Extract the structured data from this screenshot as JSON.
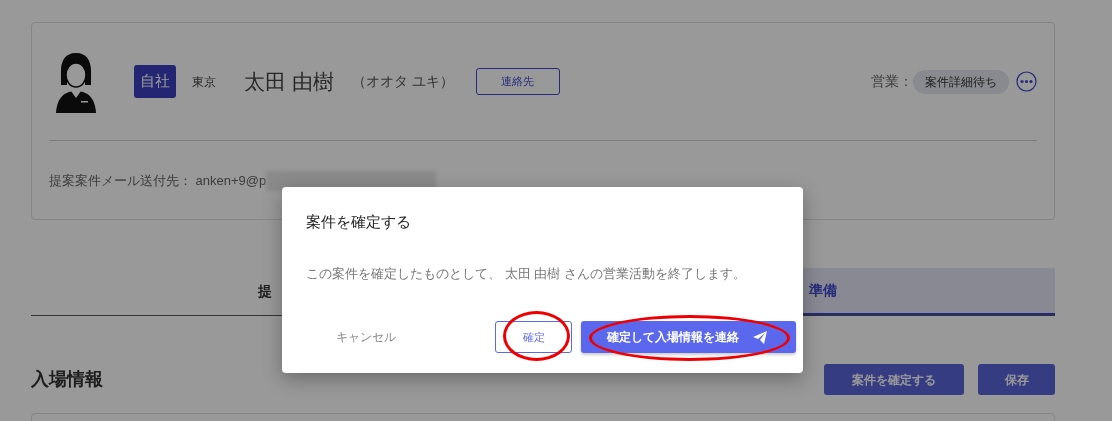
{
  "profile": {
    "badge": "自社",
    "location": "東京",
    "name": "太田 由樹",
    "kana": "（オオタ ユキ）",
    "contact_button": "連絡先",
    "status_label": "営業：",
    "status": "案件詳細待ち",
    "email_label": "提案案件メール送付先：",
    "email": "anken+9@p"
  },
  "tabs": [
    {
      "label": "提",
      "selected": false
    },
    {
      "label": "準備",
      "selected": true
    }
  ],
  "section": {
    "title": "入場情報",
    "buttons": [
      {
        "label": "案件を確定する"
      },
      {
        "label": "保存"
      }
    ]
  },
  "dialog": {
    "title": "案件を確定する",
    "message": "この案件を確定したものとして、 太田 由樹 さんの営業活動を終了します。",
    "buttons": [
      {
        "label": "キャンセル",
        "kind": "text",
        "highlighted": false
      },
      {
        "label": "確定",
        "kind": "outline",
        "highlighted": true
      },
      {
        "label": "確定して入場情報を連絡",
        "kind": "primary",
        "highlighted": true
      }
    ]
  }
}
